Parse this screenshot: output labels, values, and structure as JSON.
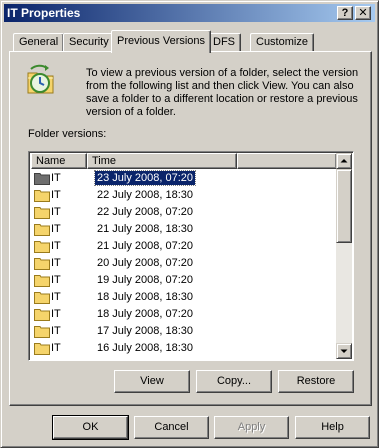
{
  "window": {
    "title": "IT Properties",
    "help_glyph": "?",
    "close_glyph": "✕"
  },
  "tabs": [
    {
      "label": "General",
      "active": false
    },
    {
      "label": "Security",
      "active": false
    },
    {
      "label": "Previous Versions",
      "active": true
    },
    {
      "label": "DFS",
      "active": false
    },
    {
      "label": "Customize",
      "active": false
    }
  ],
  "info_text": "To view a previous version of a folder, select the version from the following list and then click View.  You can also save a folder to a different location or restore a previous version of a folder.",
  "folder_versions_label": "Folder versions:",
  "list": {
    "columns": [
      "Name",
      "Time"
    ],
    "rows": [
      {
        "name": "IT",
        "time": "23 July 2008, 07:20",
        "selected": true
      },
      {
        "name": "IT",
        "time": "22 July 2008, 18:30"
      },
      {
        "name": "IT",
        "time": "22 July 2008, 07:20"
      },
      {
        "name": "IT",
        "time": "21 July 2008, 18:30"
      },
      {
        "name": "IT",
        "time": "21 July 2008, 07:20"
      },
      {
        "name": "IT",
        "time": "20 July 2008, 07:20"
      },
      {
        "name": "IT",
        "time": "19 July 2008, 07:20"
      },
      {
        "name": "IT",
        "time": "18 July 2008, 18:30"
      },
      {
        "name": "IT",
        "time": "18 July 2008, 07:20"
      },
      {
        "name": "IT",
        "time": "17 July 2008, 18:30"
      },
      {
        "name": "IT",
        "time": "16 July 2008, 18:30"
      }
    ]
  },
  "action_buttons": {
    "view": "View",
    "copy": "Copy...",
    "restore": "Restore"
  },
  "dialog_buttons": {
    "ok": "OK",
    "cancel": "Cancel",
    "apply": "Apply",
    "help": "Help"
  },
  "icons": {
    "info": "folder-clock-icon",
    "folder": "folder-icon",
    "scroll_up": "scroll-up-arrow-icon",
    "scroll_down": "scroll-down-arrow-icon"
  },
  "colors": {
    "titlebar_start": "#0a246a",
    "titlebar_end": "#a6caf0",
    "selection": "#0a246a",
    "face": "#d4d0c8",
    "folder": "#f5d46b"
  }
}
